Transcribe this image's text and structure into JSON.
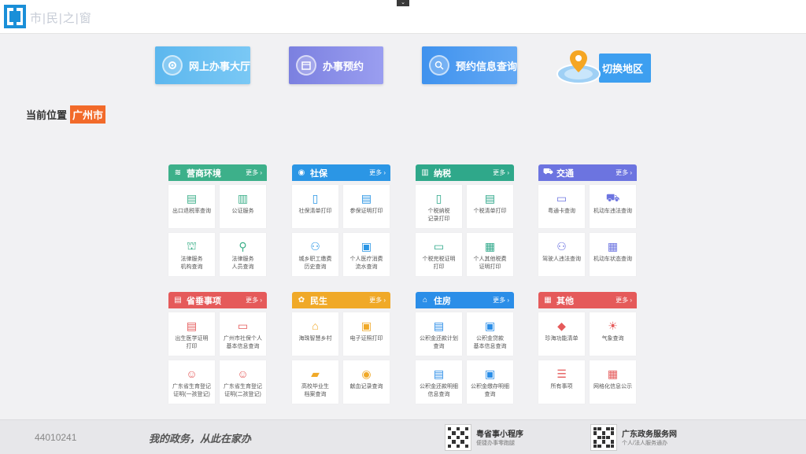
{
  "header": {
    "logo_text": "市|民|之|窗",
    "collapse_tab": "⌄"
  },
  "main_buttons": {
    "hall": "网上办事大厅",
    "booking": "办事预约",
    "booking_query": "预约信息查询",
    "switch_area": "切换地区"
  },
  "breadcrumb": {
    "label": "当前位置",
    "city": "广州市"
  },
  "more_label": "更多 ›",
  "panels": [
    {
      "title": "营商环境",
      "color": "#3db08a",
      "icon": "layers-icon",
      "glyph": "≋",
      "items": [
        {
          "label": "出口退税率查询",
          "icon": "tax-search-icon",
          "glyph": "▤"
        },
        {
          "label": "公证服务",
          "icon": "notary-building-icon",
          "glyph": "▥"
        },
        {
          "label": "法律服务\n机构查询",
          "icon": "law-building-icon",
          "glyph": "⛫"
        },
        {
          "label": "法律服务\n人员查询",
          "icon": "person-search-icon",
          "glyph": "⚲"
        }
      ]
    },
    {
      "title": "社保",
      "color": "#2b96e5",
      "icon": "social-security-icon",
      "glyph": "◉",
      "items": [
        {
          "label": "社保清单打印",
          "icon": "clipboard-icon",
          "glyph": "▯"
        },
        {
          "label": "参保证明打印",
          "icon": "certificate-icon",
          "glyph": "▤"
        },
        {
          "label": "城乡职工缴费\n历史查询",
          "icon": "users-icon",
          "glyph": "⚇"
        },
        {
          "label": "个人医疗消费\n流水查询",
          "icon": "medical-record-icon",
          "glyph": "▣"
        }
      ]
    },
    {
      "title": "纳税",
      "color": "#2fa88a",
      "icon": "building-icon",
      "glyph": "▥",
      "items": [
        {
          "label": "个税纳税\n记录打印",
          "icon": "document-icon",
          "glyph": "▯"
        },
        {
          "label": "个税清单打印",
          "icon": "list-doc-icon",
          "glyph": "▤"
        },
        {
          "label": "个税完税证明\n打印",
          "icon": "tax-certificate-icon",
          "glyph": "▭"
        },
        {
          "label": "个人其他税费\n证明打印",
          "icon": "printer-icon",
          "glyph": "▦"
        }
      ]
    },
    {
      "title": "交通",
      "color": "#6c74e0",
      "icon": "car-icon",
      "glyph": "⛟",
      "items": [
        {
          "label": "粤通卡查询",
          "icon": "card-icon",
          "glyph": "▭"
        },
        {
          "label": "机动车违法查询",
          "icon": "vehicle-icon",
          "glyph": "⛟"
        },
        {
          "label": "驾驶人违法查询",
          "icon": "driver-icon",
          "glyph": "⚇"
        },
        {
          "label": "机动车状态查询",
          "icon": "vehicle-status-icon",
          "glyph": "▦"
        }
      ]
    },
    {
      "title": "省垂事项",
      "color": "#e55a5a",
      "icon": "document-list-icon",
      "glyph": "▤",
      "items": [
        {
          "label": "出生医学证明\n打印",
          "icon": "birth-certificate-icon",
          "glyph": "▤"
        },
        {
          "label": "广州市社保个人\n基本信息查询",
          "icon": "id-card-icon",
          "glyph": "▭"
        },
        {
          "label": "广东省生育登记\n证明(一孩登记)",
          "icon": "baby-icon",
          "glyph": "☺"
        },
        {
          "label": "广东省生育登记\n证明(二孩登记)",
          "icon": "baby-icon",
          "glyph": "☺"
        }
      ]
    },
    {
      "title": "民生",
      "color": "#f0a928",
      "icon": "hands-icon",
      "glyph": "✿",
      "items": [
        {
          "label": "海珠智慧乡村",
          "icon": "village-icon",
          "glyph": "⌂"
        },
        {
          "label": "电子证照打印",
          "icon": "e-license-icon",
          "glyph": "▣"
        },
        {
          "label": "高校毕业生\n档案查询",
          "icon": "graduate-icon",
          "glyph": "▰"
        },
        {
          "label": "献血记录查询",
          "icon": "blood-drop-icon",
          "glyph": "◉"
        }
      ]
    },
    {
      "title": "住房",
      "color": "#2b8ee8",
      "icon": "house-icon",
      "glyph": "⌂",
      "items": [
        {
          "label": "公积金还款计划\n查询",
          "icon": "fund-plan-icon",
          "glyph": "▤"
        },
        {
          "label": "公积金贷款\n基本信息查询",
          "icon": "fund-loan-icon",
          "glyph": "▣"
        },
        {
          "label": "公积金还款明细\n信息查询",
          "icon": "fund-detail-icon",
          "glyph": "▤"
        },
        {
          "label": "公积金缴存明细\n查询",
          "icon": "fund-deposit-icon",
          "glyph": "▣"
        }
      ]
    },
    {
      "title": "其他",
      "color": "#e55a5a",
      "icon": "grid-icon",
      "glyph": "▦",
      "items": [
        {
          "label": "珍海功能清单",
          "icon": "cube-icon",
          "glyph": "◆"
        },
        {
          "label": "气象查询",
          "icon": "weather-icon",
          "glyph": "☀"
        },
        {
          "label": "所有事项",
          "icon": "list-icon",
          "glyph": "☰"
        },
        {
          "label": "网格化信息公示",
          "icon": "grid-info-icon",
          "glyph": "▦"
        }
      ]
    }
  ],
  "footer": {
    "code": "44010241",
    "slogan": "我的政务，从此在家办",
    "mini_title": "粤省事小程序",
    "mini_sub": "便捷办事零跑腿",
    "portal_title": "广东政务服务网",
    "portal_sub": "个人/法人服务通办"
  }
}
